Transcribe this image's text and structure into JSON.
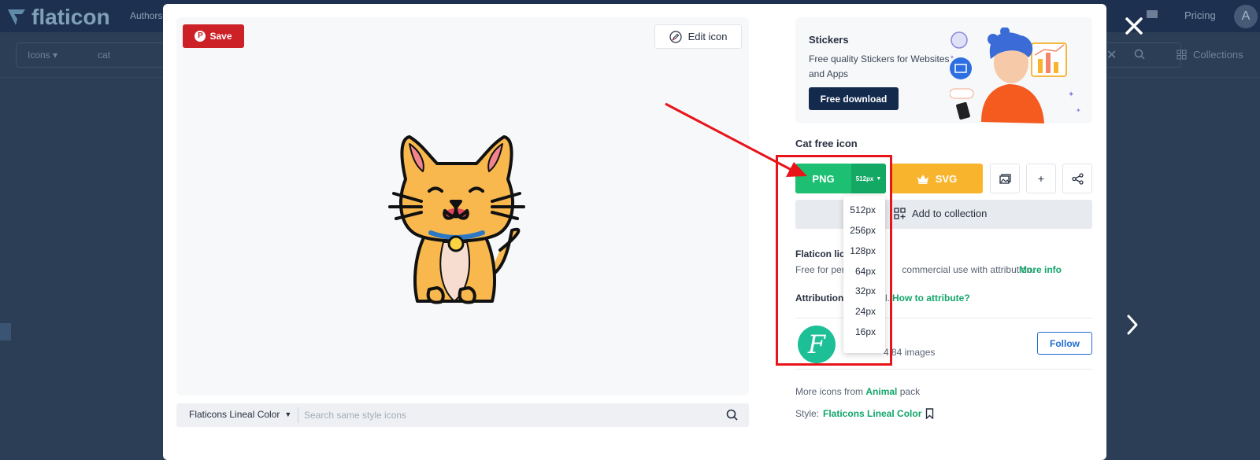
{
  "background": {
    "logo": "flaticon",
    "nav_authors": "Authors",
    "nav_pricing": "Pricing",
    "avatar_letter": "A",
    "search_type": "Icons",
    "search_query": "cat",
    "collections_label": "Collections"
  },
  "preview": {
    "save_label": "Save",
    "edit_label": "Edit icon",
    "style_name": "Flaticons Lineal Color",
    "style_search_placeholder": "Search same style icons"
  },
  "stickers": {
    "title": "Stickers",
    "description": "Free quality Stickers for Websites and Apps",
    "button": "Free download"
  },
  "icon": {
    "title": "Cat free icon",
    "png_label": "PNG",
    "size_label": "512px",
    "svg_label": "SVG",
    "add_to_collection": "Add to collection",
    "plus_label": "+"
  },
  "license": {
    "title_fragment": "Flaticon lice",
    "text_fragment": "Free for per",
    "text_fragment2": "commercial use with attribution.",
    "more_info": "More info",
    "attribution_label": "Attribution",
    "attribution_fragment": "l.",
    "how_to_attribute": "How to attribute?"
  },
  "author": {
    "avatar_letter": "F",
    "count_fragment": "4,84 images",
    "follow": "Follow"
  },
  "more": {
    "prefix": "More icons from",
    "pack": "Animal",
    "suffix": "pack",
    "style_prefix": "Style:",
    "style_name": "Flaticons Lineal Color"
  },
  "size_options": [
    "512px",
    "256px",
    "128px",
    "64px",
    "32px",
    "24px",
    "16px"
  ],
  "colors": {
    "png_green": "#1dbf73",
    "svg_orange": "#f9b42d",
    "highlight_red": "#e8141a",
    "save_red": "#cc2127",
    "link_green": "#12a56b"
  }
}
